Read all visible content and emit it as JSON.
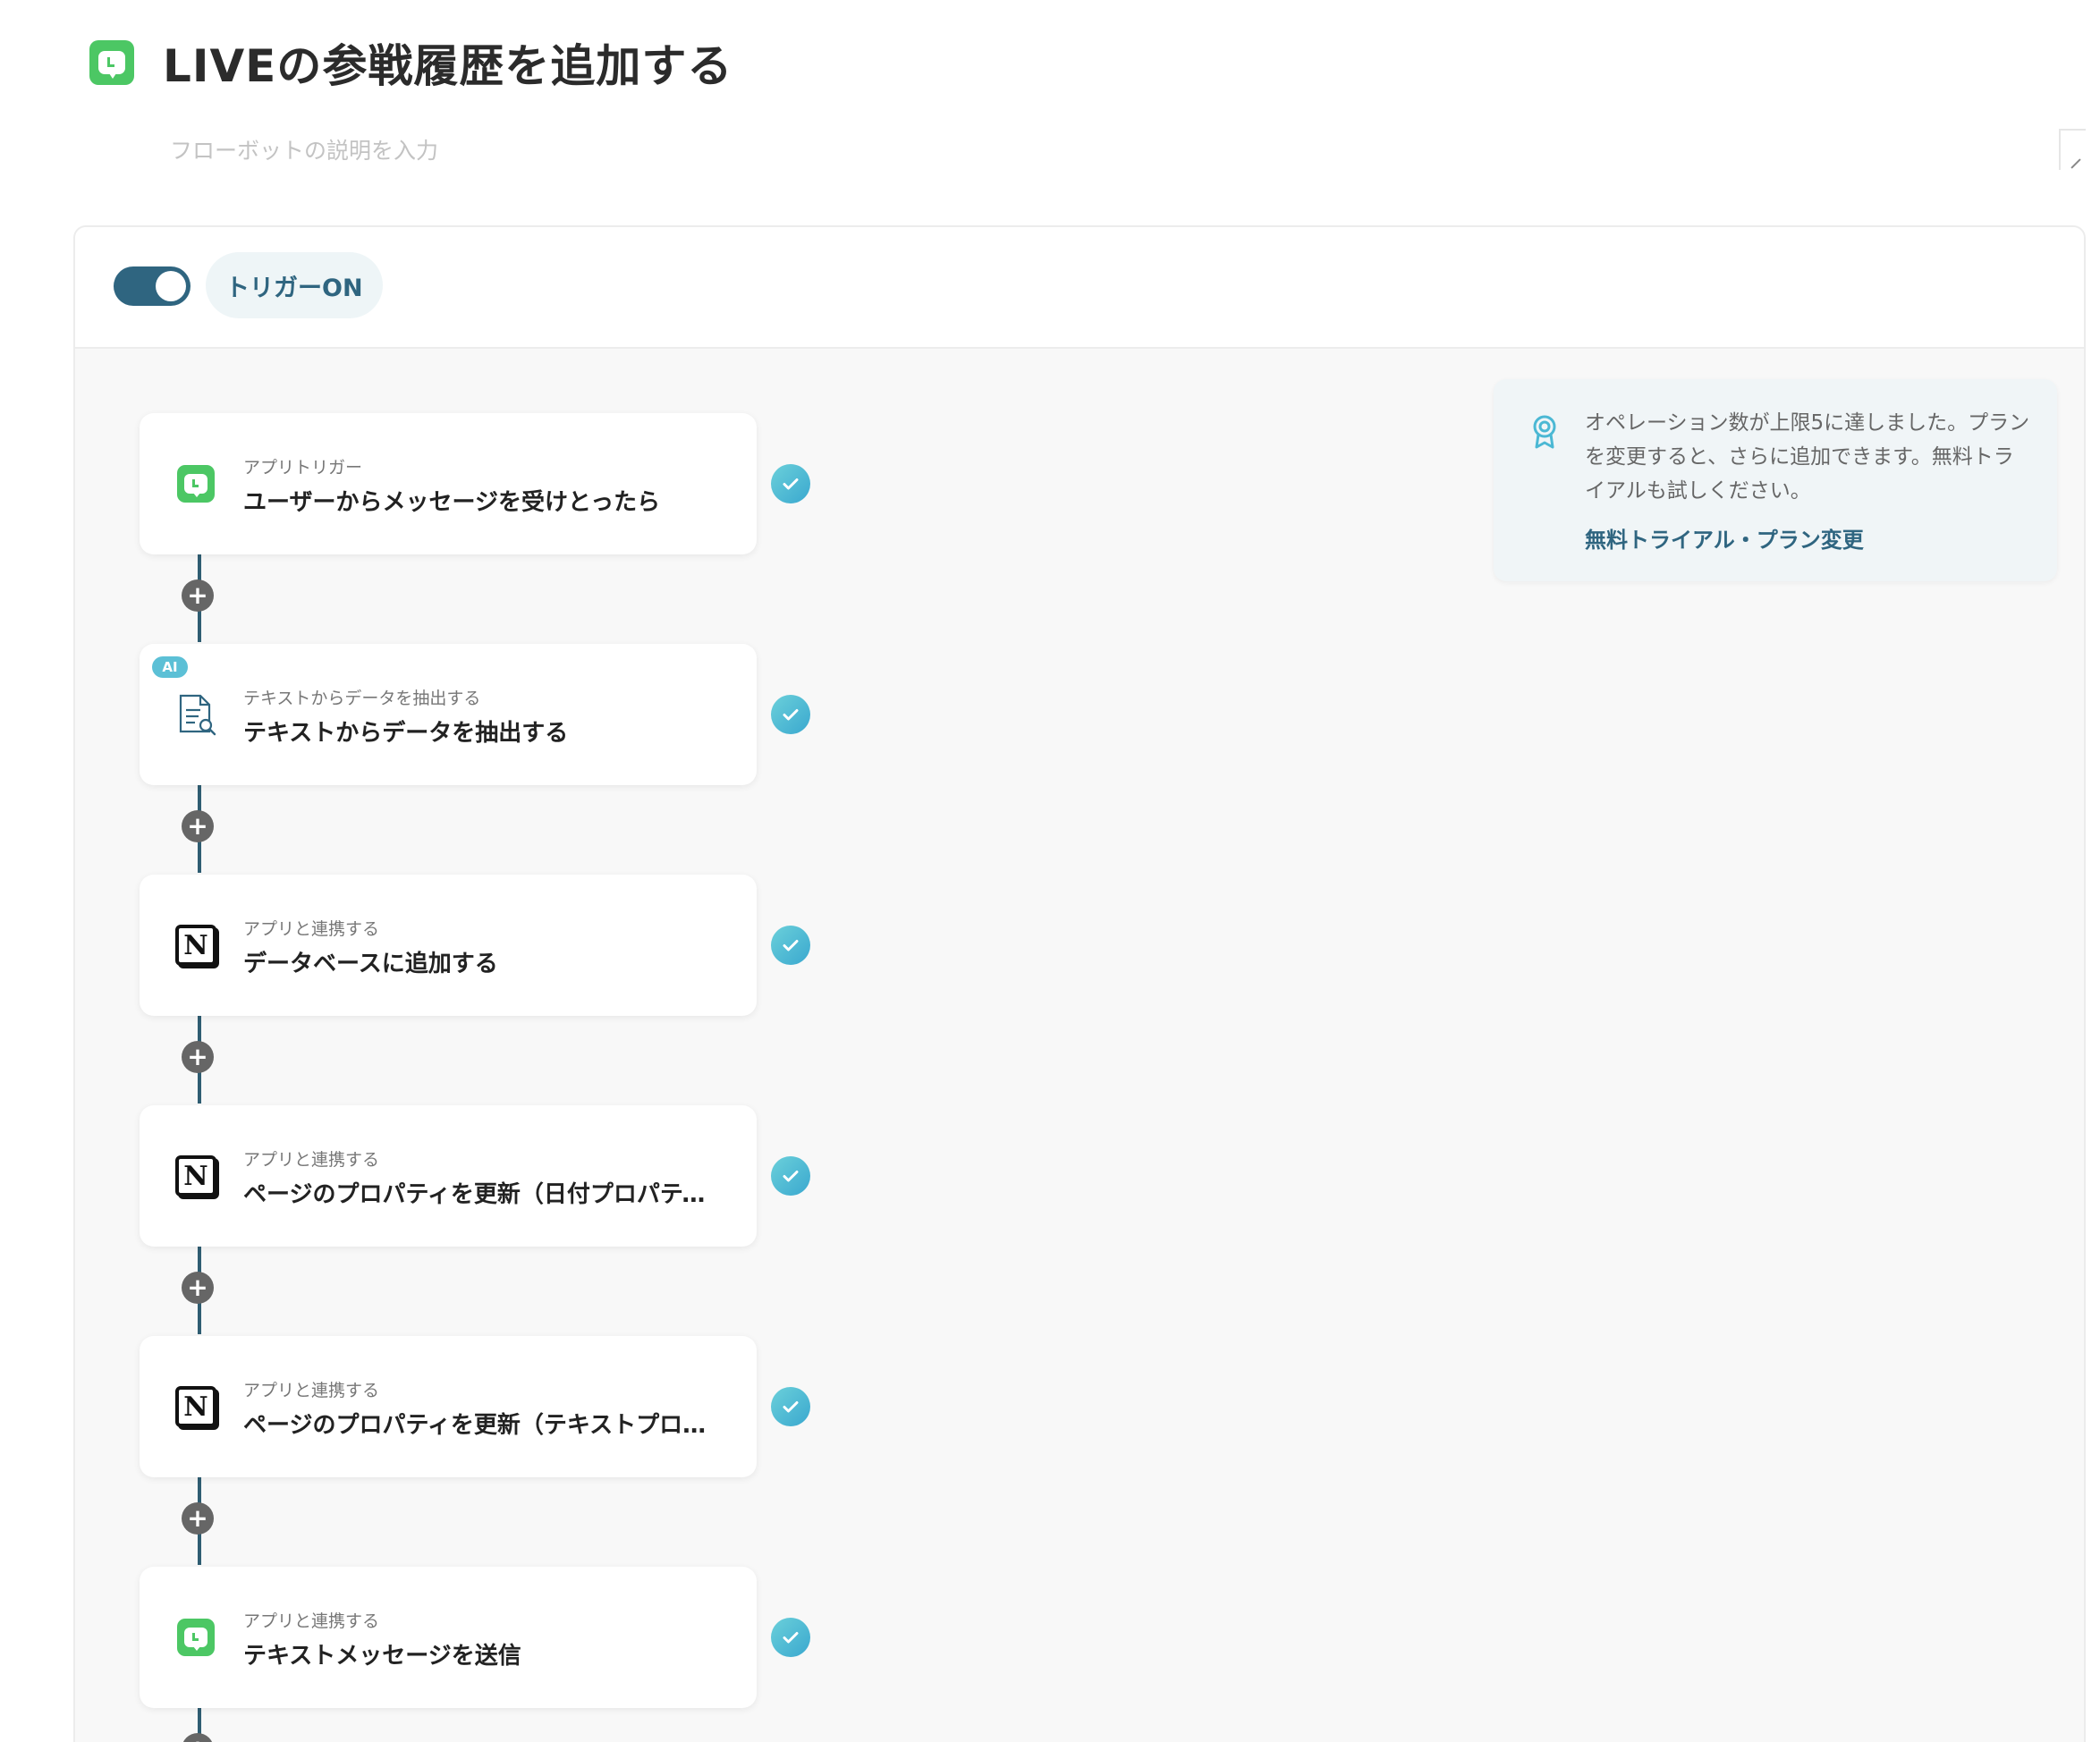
{
  "header": {
    "title": "LIVEの参戦履歴を追加する",
    "description_placeholder": "フローボットの説明を入力"
  },
  "trigger": {
    "status_label": "トリガーON",
    "enabled": true
  },
  "steps": [
    {
      "type_label": "アプリトリガー",
      "title": "ユーザーからメッセージを受けとったら",
      "icon": "line-icon",
      "ai": false,
      "done": true
    },
    {
      "type_label": "テキストからデータを抽出する",
      "title": "テキストからデータを抽出する",
      "icon": "document-search-icon",
      "ai": true,
      "ai_label": "AI",
      "done": true
    },
    {
      "type_label": "アプリと連携する",
      "title": "データベースに追加する",
      "icon": "notion-icon",
      "ai": false,
      "done": true
    },
    {
      "type_label": "アプリと連携する",
      "title": "ページのプロパティを更新（日付プロパティ）",
      "icon": "notion-icon",
      "ai": false,
      "done": true
    },
    {
      "type_label": "アプリと連携する",
      "title": "ページのプロパティを更新（テキストプロパ…",
      "icon": "notion-icon",
      "ai": false,
      "done": true
    },
    {
      "type_label": "アプリと連携する",
      "title": "テキストメッセージを送信",
      "icon": "line-icon",
      "ai": false,
      "done": true
    }
  ],
  "limit_notice": {
    "message": "オペレーション数が上限5に達しました。プランを変更すると、さらに追加できます。無料トライアルも試しください。",
    "link_label": "無料トライアル・プラン変更"
  },
  "colors": {
    "accent": "#2f6580",
    "line_green": "#4cc764",
    "check_teal": "#4bb8d4"
  }
}
